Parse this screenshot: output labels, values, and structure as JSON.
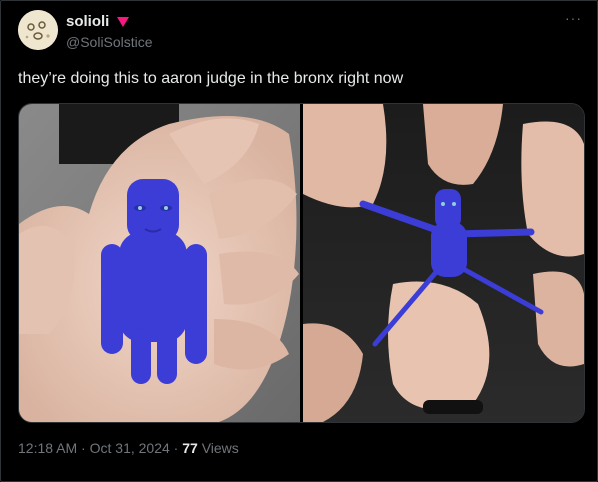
{
  "tweet": {
    "author_name": "solioli",
    "handle": "@SoliSolstice",
    "text": "they’re doing this to aaron judge in the bronx right now",
    "time": "12:18 AM",
    "date": "Oct 31, 2024",
    "separator": "·",
    "views_count": "77",
    "views_label": "Views",
    "more_label": "···"
  },
  "icons": {
    "badge": "heart-arrow-badge-icon",
    "more": "more-options-icon"
  },
  "colors": {
    "background": "#000000",
    "text_primary": "#e7e9ea",
    "text_secondary": "#71767b",
    "badge": "#f91880",
    "figure_blue": "#3d3fd8"
  }
}
